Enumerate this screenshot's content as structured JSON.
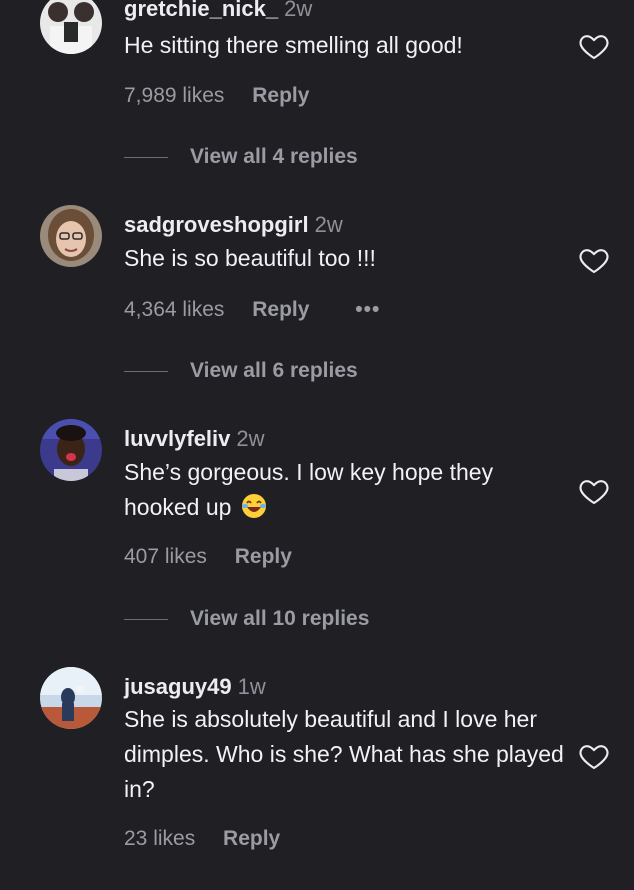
{
  "comments": [
    {
      "username": "gretchie_nick_",
      "time": "2w",
      "text": "He sitting there smelling all good!",
      "likes": "7,989 likes",
      "reply": "Reply",
      "view_replies": "View all 4 replies"
    },
    {
      "username": "sadgroveshopgirl",
      "time": "2w",
      "text": "She is so beautiful too !!!",
      "likes": "4,364 likes",
      "reply": "Reply",
      "more": "•••",
      "view_replies": "View all 6 replies"
    },
    {
      "username": "luvvlyfeliv",
      "time": "2w",
      "text": "She’s gorgeous. I low key hope they hooked up",
      "likes": "407 likes",
      "reply": "Reply",
      "view_replies": "View all 10 replies"
    },
    {
      "username": "jusaguy49",
      "time": "1w",
      "text": "She is absolutely beautiful and I love her dimples. Who is she? What has she played in?",
      "likes": "23 likes",
      "reply": "Reply"
    }
  ],
  "icons": {
    "heart": "heart-outline-icon",
    "emoji": "laughing-tears-emoji-icon",
    "more": "more-options-icon"
  },
  "colors": {
    "background": "#1f1f24",
    "text": "#f2f2f5",
    "muted": "#9a9ba3"
  }
}
